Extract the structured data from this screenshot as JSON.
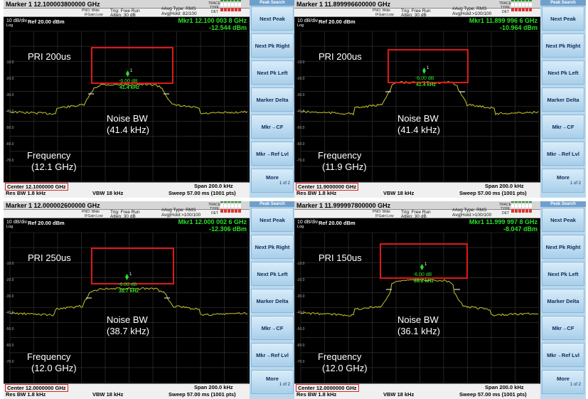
{
  "common": {
    "menu_title": "Peak Search",
    "menu_buttons": [
      "Next Peak",
      "Next Pk Right",
      "Next Pk Left",
      "Marker Delta",
      "Mkr→CF",
      "Mkr→Ref Lvl"
    ],
    "more_label": "More",
    "more_sub": "1 of 2",
    "pno": "PNO: Wide",
    "ifgain": "IFGain:Low",
    "trig": "Trig: Free Run",
    "atten": "Atten: 30 dB",
    "avg_type": "#Avg Type: RMS",
    "trace_labels": [
      "TRACE",
      "TYPE",
      "DET"
    ],
    "scale": "10 dB/div",
    "ref": "Ref 20.00 dBm",
    "log": "Log",
    "res_bw": "Res BW 1.8 kHz",
    "vbw": "VBW 18 kHz",
    "span": "Span 200.0 kHz",
    "sweep": "Sweep  57.00 ms (1001 pts)",
    "marker_delta": "-6.00 dB",
    "noise_label": "Noise BW",
    "freq_label": "Frequency",
    "y_ticks": [
      "10.0",
      "0.00",
      "-10.0",
      "-20.0",
      "-30.0",
      "-40.0",
      "-50.0",
      "-60.0",
      "-70.0"
    ],
    "colors": {
      "trace": "#c8c82a",
      "marker": "#29e029",
      "highlight": "#e01818",
      "menu_bg": "#b8d8ee"
    }
  },
  "panels": [
    {
      "marker_title": "Marker 1 12.100003800000 GHz",
      "avg_hold": "Avg|Hold: 82/100",
      "mkr_readout": "Mkr1 12.100 003 8 GHz",
      "mkr_amp": "-12.544 dBm",
      "pri": "PRI 200us",
      "noise_value": "(41.4 kHz)",
      "freq_value": "(12.1 GHz)",
      "marker_bw": "41.4 kHz",
      "center": "Center 12.1000000 GHz"
    },
    {
      "marker_title": "Marker 1 11.899996600000 GHz",
      "avg_hold": "Avg|Hold:>100/100",
      "mkr_readout": "Mkr1 11.899 996 6 GHz",
      "mkr_amp": "-10.964 dBm",
      "pri": "PRI 200us",
      "noise_value": "(41.4 kHz)",
      "freq_value": "(11.9 GHz)",
      "marker_bw": "41.4 kHz",
      "center": "Center 11.9000000 GHz"
    },
    {
      "marker_title": "Marker 1 12.000002600000 GHz",
      "avg_hold": "Avg|Hold:>100/100",
      "mkr_readout": "Mkr1 12.000 002 6 GHz",
      "mkr_amp": "-12.306 dBm",
      "pri": "PRI 250us",
      "noise_value": "(38.7 kHz)",
      "freq_value": "(12.0 GHz)",
      "marker_bw": "38.7 kHz",
      "center": "Center 12.0000000 GHz"
    },
    {
      "marker_title": "Marker 1 11.999997800000 GHz",
      "avg_hold": "Avg|Hold:>100/100",
      "mkr_readout": "Mkr1 11.999 997 8 GHz",
      "mkr_amp": "-8.047 dBm",
      "pri": "PRI 150us",
      "noise_value": "(36.1 kHz)",
      "freq_value": "(12.0 GHz)",
      "marker_bw": "36.1 kHz",
      "center": "Center 12.0000000 GHz"
    }
  ]
}
